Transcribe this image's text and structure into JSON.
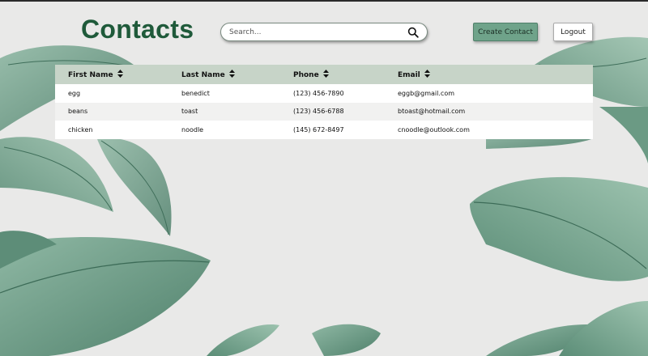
{
  "header": {
    "title": "Contacts",
    "search_placeholder": "Search...",
    "search_icon": "magnifier-icon",
    "create_label": "Create Contact",
    "logout_label": "Logout"
  },
  "table": {
    "columns": [
      "First Name",
      "Last Name",
      "Phone",
      "Email"
    ],
    "sort_icon": "sort-arrows-icon",
    "rows": [
      {
        "first": "egg",
        "last": "benedict",
        "phone": "(123) 456-7890",
        "email": "eggb@gmail.com"
      },
      {
        "first": "beans",
        "last": "toast",
        "phone": "(123) 456-6788",
        "email": "btoast@hotmail.com"
      },
      {
        "first": "chicken",
        "last": "noodle",
        "phone": "(145) 672-8497",
        "email": "cnoodle@outlook.com"
      }
    ]
  },
  "colors": {
    "title": "#1f5a3a",
    "create_button": "#6fa38a",
    "table_header": "#c7d4c8",
    "background": "#e9e9e8",
    "leaf": "#6f9e88"
  }
}
